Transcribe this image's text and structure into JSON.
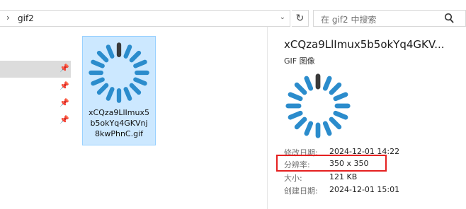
{
  "addressbar": {
    "chevron": "›",
    "path": "gif2",
    "dropdown_icon": "chevron-down-icon"
  },
  "refresh_icon": "refresh-icon",
  "search": {
    "placeholder": "在 gif2 中搜索",
    "icon": "search-icon"
  },
  "nav": {
    "pins": [
      "pin-icon",
      "pin-icon",
      "pin-icon",
      "pin-icon"
    ]
  },
  "file": {
    "name": "xCQza9LlImux5b5okYq4GKVnj8kwPhnC.gif",
    "name_lines": [
      "xCQza9LlImux5",
      "b5okYq4GKVnj",
      "8kwPhnC.gif"
    ]
  },
  "details": {
    "title": "xCQza9LlImux5b5okYq4GKV...",
    "type": "GIF 图像",
    "rows": [
      {
        "label": "修改日期:",
        "value": "2024-12-01 14:22"
      },
      {
        "label": "分辨率:",
        "value": "350 x 350"
      },
      {
        "label": "大小:",
        "value": "121 KB"
      },
      {
        "label": "创建日期:",
        "value": "2024-12-01 15:01"
      }
    ]
  },
  "colors": {
    "spinner_active": "#3a3a3a",
    "spinner_blue": "#2b8ccc",
    "selection_bg": "#cce8ff",
    "highlight_border": "#e52020"
  }
}
